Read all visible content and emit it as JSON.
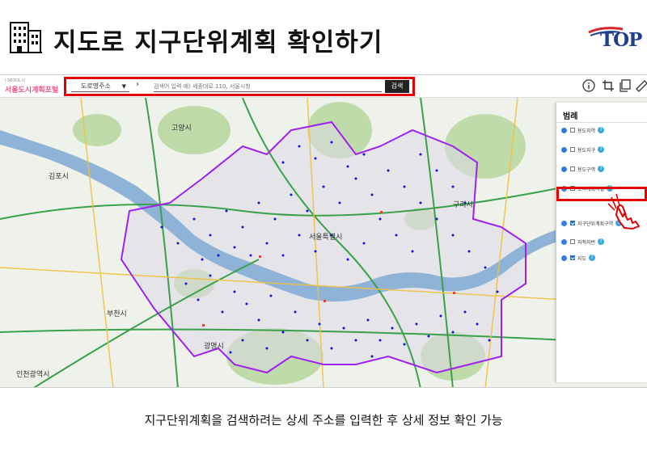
{
  "header": {
    "title": "지도로 지구단위계획 확인하기",
    "building_icon": "building-icon",
    "logo_text": "TOP"
  },
  "toolbar": {
    "portal_sub": "i·SEOUL·U",
    "portal_name": "서울도시계획포털",
    "address_type": "도로명주소",
    "search_placeholder": "검색어 입력 예) 세종대로 110, 서울시청",
    "search_button": "검색",
    "icons": [
      "info-icon",
      "crop-icon",
      "copy-icon",
      "ruler-icon",
      "draw-icon"
    ]
  },
  "map": {
    "labels": [
      {
        "text": "고양시"
      },
      {
        "text": "김포시"
      },
      {
        "text": "구리시"
      },
      {
        "text": "부천시"
      },
      {
        "text": "광명시"
      },
      {
        "text": "인천광역시"
      },
      {
        "text": "서울특별시"
      }
    ],
    "colors": {
      "river": "#8fb3d6",
      "boundary": "#a020f0",
      "parcel": "#1010e0",
      "forest": "#b9d8a2",
      "land": "#eaf1e6"
    }
  },
  "legend": {
    "title": "범례",
    "items": [
      {
        "label": "용도지역",
        "checked": false
      },
      {
        "label": "용도지구",
        "checked": false
      },
      {
        "label": "용도구역",
        "checked": false
      },
      {
        "label": "도시계획시설",
        "checked": false
      },
      {
        "label": "지구단위계획구역",
        "checked": true
      },
      {
        "label": "지적지번",
        "checked": false
      },
      {
        "label": "지도",
        "checked": true
      }
    ]
  },
  "caption": "지구단위계획을 검색하려는 상세 주소를 입력한 후 상세 정보 확인 가능"
}
